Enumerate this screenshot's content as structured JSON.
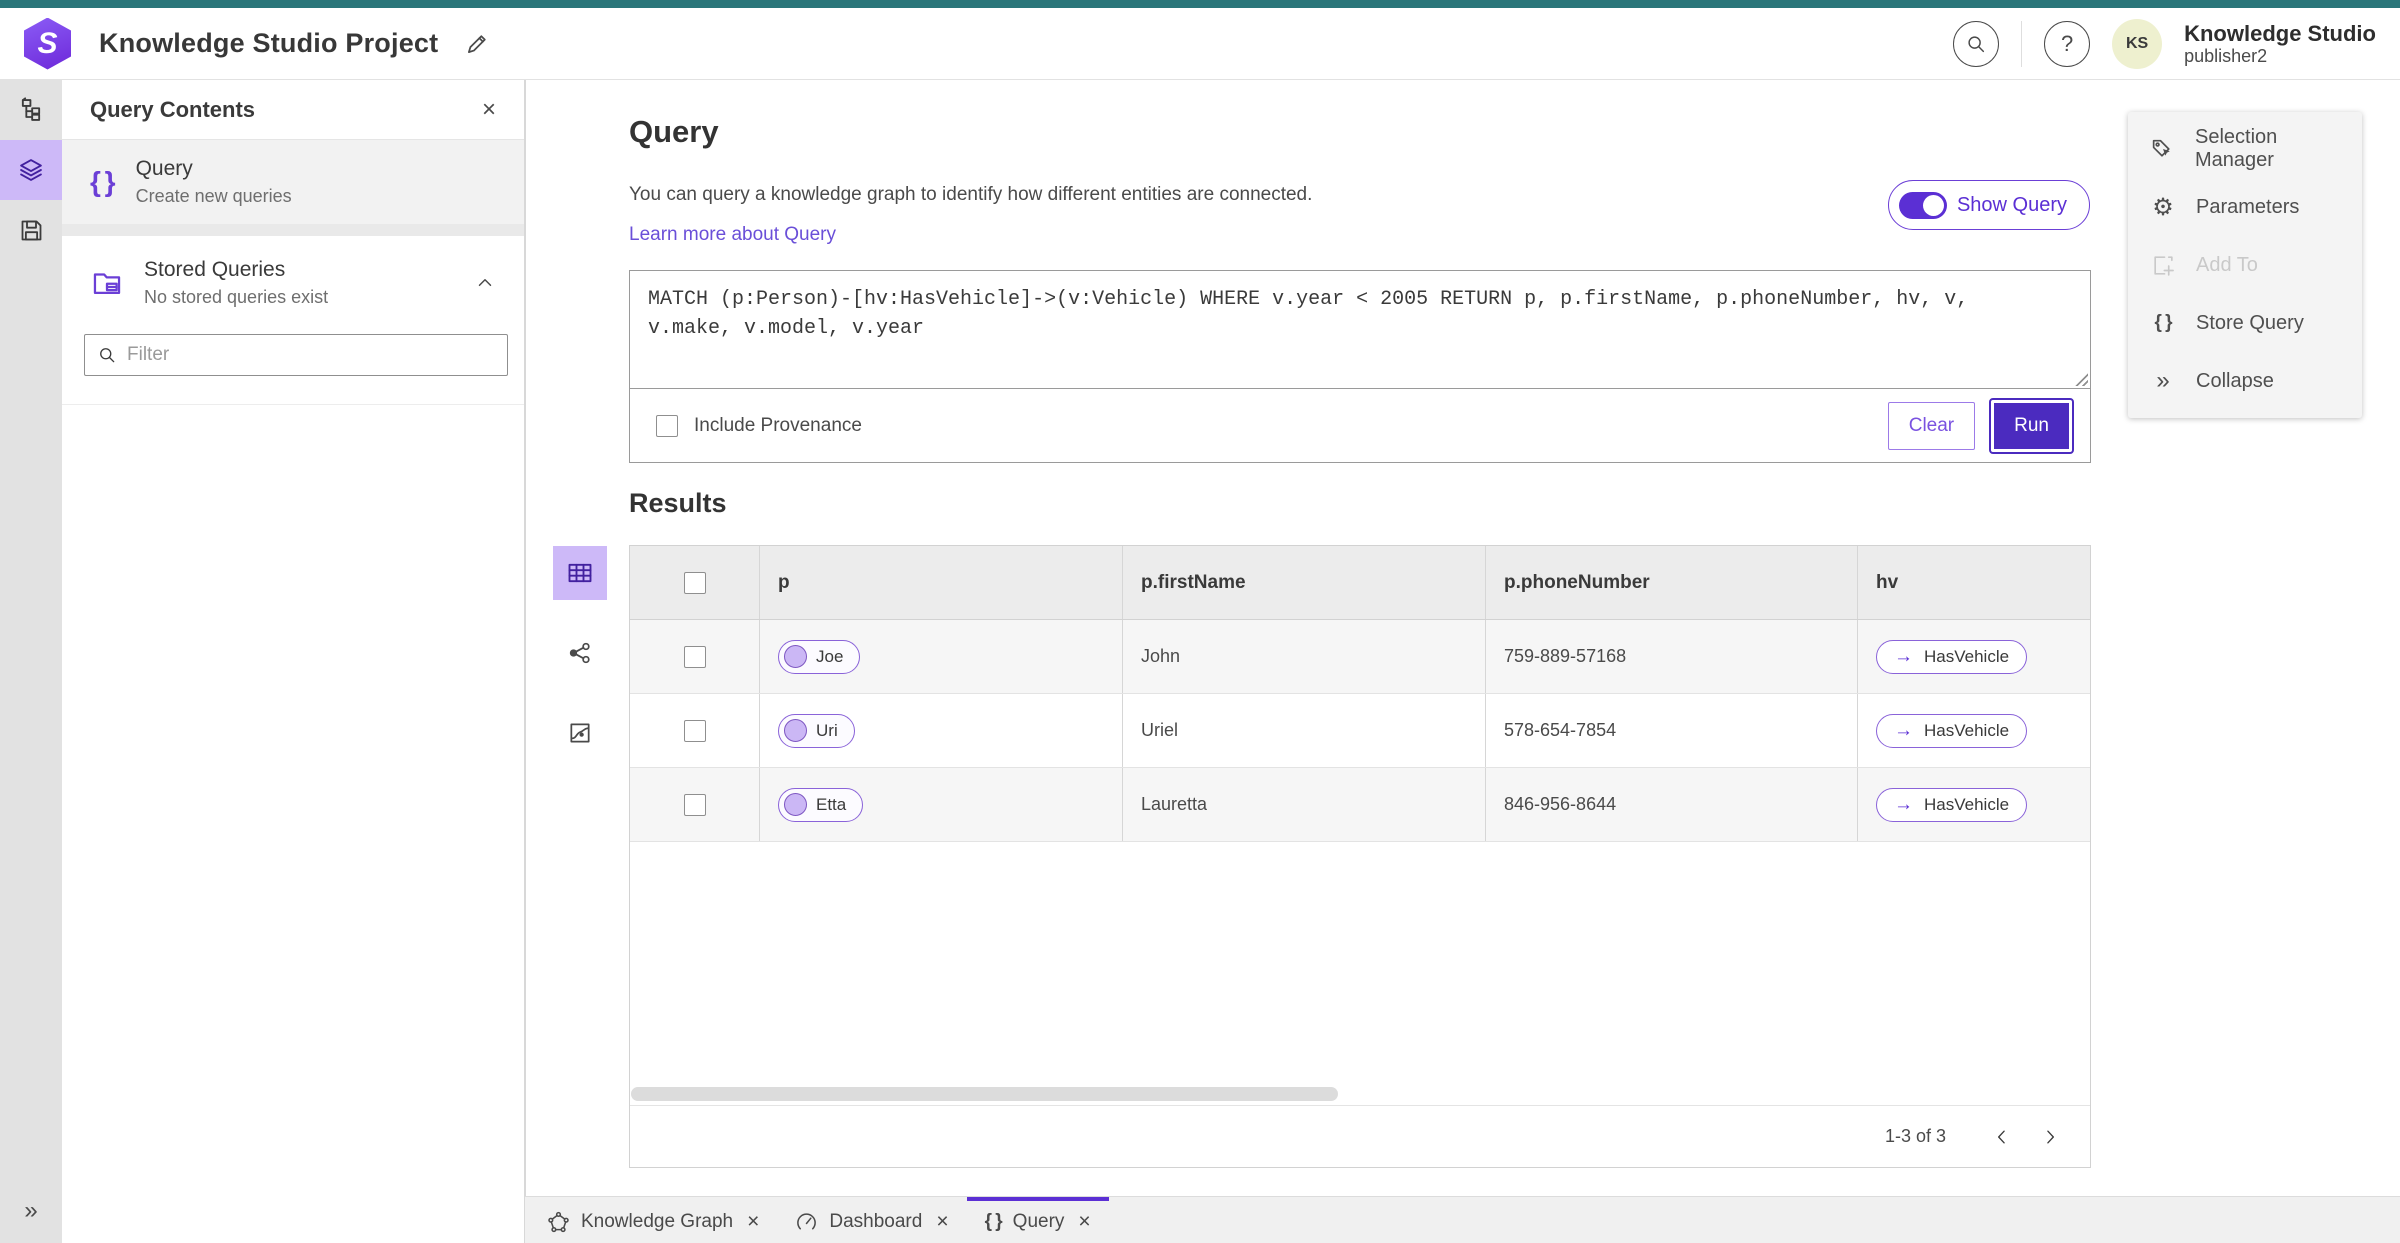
{
  "header": {
    "title": "Knowledge Studio Project",
    "account_name": "Knowledge Studio",
    "account_role": "publisher2",
    "avatar_initials": "KS"
  },
  "left_panel": {
    "title": "Query Contents",
    "query_item_title": "Query",
    "query_item_subtitle": "Create new queries",
    "stored_title": "Stored Queries",
    "stored_subtitle": "No stored queries exist",
    "filter_placeholder": "Filter"
  },
  "query_section": {
    "title": "Query",
    "description": "You can query a knowledge graph to identify how different entities are connected.",
    "learn_more_label": "Learn more about Query",
    "show_query_label": "Show Query",
    "query_text": "MATCH (p:Person)-[hv:HasVehicle]->(v:Vehicle) WHERE v.year < 2005 RETURN p, p.firstName, p.phoneNumber, hv, v, v.make, v.model, v.year",
    "include_provenance_label": "Include Provenance",
    "clear_label": "Clear",
    "run_label": "Run"
  },
  "results": {
    "title": "Results",
    "columns": {
      "p": "p",
      "firstName": "p.firstName",
      "phoneNumber": "p.phoneNumber",
      "hv": "hv"
    },
    "rows": [
      {
        "p": "Joe",
        "firstName": "John",
        "phoneNumber": "759-889-57168",
        "hv": "HasVehicle"
      },
      {
        "p": "Uri",
        "firstName": "Uriel",
        "phoneNumber": "578-654-7854",
        "hv": "HasVehicle"
      },
      {
        "p": "Etta",
        "firstName": "Lauretta",
        "phoneNumber": "846-956-8644",
        "hv": "HasVehicle"
      }
    ],
    "pagination_label": "1-3 of 3"
  },
  "right_panel": {
    "selection_manager": "Selection Manager",
    "parameters": "Parameters",
    "add_to": "Add To",
    "store_query": "Store Query",
    "collapse": "Collapse"
  },
  "tabs": {
    "knowledge_graph": "Knowledge Graph",
    "dashboard": "Dashboard",
    "query": "Query"
  },
  "icons": {
    "braces": "{ }",
    "close": "×",
    "collapse_chevrons": "»",
    "gear": "⚙",
    "question_mark": "?",
    "arrow_right": "→",
    "logo_letter": "S"
  },
  "colors": {
    "top_strip_teal": "#2a767a",
    "accent_purple": "#5b2fd4",
    "run_button_purple": "#4b2bbf",
    "chip_border_purple": "#8a63d9",
    "active_rail_bg": "#cdb9f8",
    "avatar_bg": "#eef0cf"
  }
}
